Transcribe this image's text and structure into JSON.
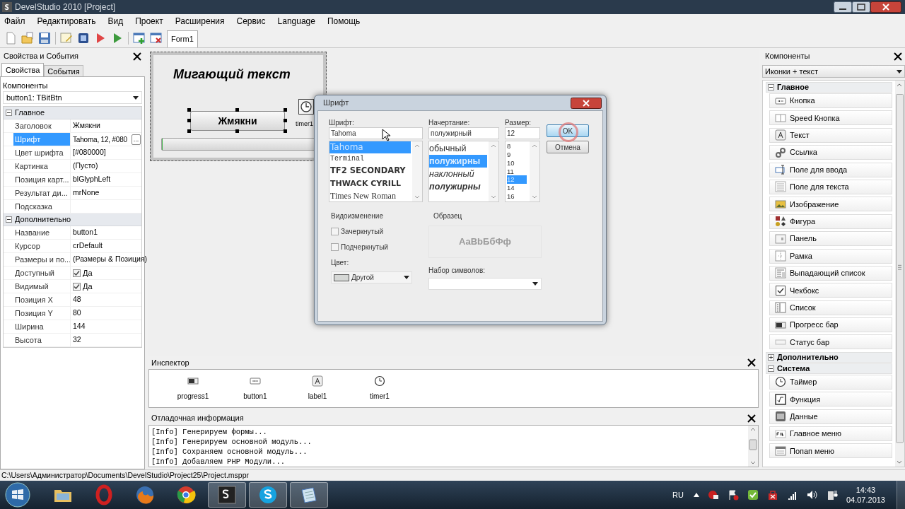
{
  "window": {
    "title": "DevelStudio 2010 [Project]"
  },
  "menu": [
    "Файл",
    "Редактировать",
    "Вид",
    "Проект",
    "Расширения",
    "Сервис",
    "Language",
    "Помощь"
  ],
  "toolbar": {
    "tabs": [
      {
        "label": "Form1",
        "selected": true
      }
    ]
  },
  "properties": {
    "title": "Свойства и События",
    "tabs": [
      {
        "label": "Свойства",
        "selected": true
      },
      {
        "label": "События",
        "selected": false
      }
    ],
    "components_label": "Компоненты",
    "component_select": "button1: TBitBtn",
    "groups": [
      {
        "title": "Главное",
        "expanded": true,
        "rows": [
          {
            "kind": "text",
            "name": "Заголовок",
            "value": "Жмякни",
            "selected": false
          },
          {
            "kind": "button",
            "name": "Шрифт",
            "value": "Tahoma, 12, #080",
            "button_label": "...",
            "selected": true
          },
          {
            "kind": "text",
            "name": "Цвет шрифта",
            "value": "[#080000]",
            "selected": false
          },
          {
            "kind": "text",
            "name": "Картинка",
            "value": "(Пусто)",
            "selected": false
          },
          {
            "kind": "text",
            "name": "Позиция карт...",
            "value": "blGlyphLeft",
            "selected": false
          },
          {
            "kind": "text",
            "name": "Результат ди...",
            "value": "mrNone",
            "selected": false
          },
          {
            "kind": "text",
            "name": "Подсказка",
            "selected": false
          }
        ]
      },
      {
        "title": "Дополнительно",
        "expanded": true,
        "rows": [
          {
            "kind": "text",
            "name": "Название",
            "value": "button1",
            "selected": false
          },
          {
            "kind": "text",
            "name": "Курсор",
            "value": "crDefault",
            "selected": false
          },
          {
            "kind": "text",
            "name": "Размеры и по...",
            "value": "(Размеры & Позиция)",
            "selected": false
          },
          {
            "kind": "checkbox",
            "name": "Доступный",
            "value": "Да",
            "checked": true,
            "selected": false
          },
          {
            "kind": "checkbox",
            "name": "Видимый",
            "value": "Да",
            "checked": true,
            "selected": false
          },
          {
            "kind": "text",
            "name": "Позиция X",
            "value": "48",
            "selected": false
          },
          {
            "kind": "text",
            "name": "Позиция Y",
            "value": "80",
            "selected": false
          },
          {
            "kind": "text",
            "name": "Ширина",
            "value": "144",
            "selected": false
          },
          {
            "kind": "text",
            "name": "Высота",
            "value": "32",
            "selected": false
          }
        ]
      }
    ]
  },
  "designer": {
    "form_label": "Мигающий текст",
    "button_label": "Жмякни",
    "timer_label": "timer1",
    "progress": {
      "level": 0
    }
  },
  "font_dialog": {
    "title": "Шрифт",
    "font_label": "Шрифт:",
    "font_value": "Tahoma",
    "fonts": [
      {
        "label": "Tahoma",
        "kind": "sans",
        "selected": true
      },
      {
        "label": "Terminal",
        "kind": "mono",
        "selected": false
      },
      {
        "label": "TF2 SECONDARY",
        "kind": "display",
        "selected": false
      },
      {
        "label": "THWACK CYRILL",
        "kind": "heavy",
        "selected": false
      },
      {
        "label": "Times New Roman",
        "kind": "serif",
        "selected": false
      }
    ],
    "style_label": "Начертание:",
    "style_value": "полужирный",
    "styles": [
      {
        "label": "обычный",
        "kind": "regular",
        "selected": false
      },
      {
        "label": "полужирны",
        "kind": "bold",
        "selected": true
      },
      {
        "label": "наклонный",
        "kind": "italic",
        "selected": false
      },
      {
        "label": "полужирны",
        "kind": "bolditalic",
        "selected": false
      }
    ],
    "size_label": "Размер:",
    "size_value": "12",
    "sizes": [
      {
        "label": "8",
        "selected": false
      },
      {
        "label": "9",
        "selected": false
      },
      {
        "label": "10",
        "selected": false
      },
      {
        "label": "11",
        "selected": false
      },
      {
        "label": "12",
        "selected": true
      },
      {
        "label": "14",
        "selected": false
      },
      {
        "label": "16",
        "selected": false
      }
    ],
    "ok": "OK",
    "cancel": "Отмена",
    "effects_title": "Видоизменение",
    "effects": [
      {
        "label": "Зачеркнутый",
        "checked": false
      },
      {
        "label": "Подчеркнутый",
        "checked": false
      }
    ],
    "color_label": "Цвет:",
    "color_value": "Другой",
    "sample_title": "Образец",
    "sample_text": "AaBbБбФф",
    "charset_label": "Набор символов:"
  },
  "inspector": {
    "title": "Инспектор",
    "items": [
      {
        "label": "progress1",
        "kind": "progress"
      },
      {
        "label": "button1",
        "kind": "button"
      },
      {
        "label": "label1",
        "kind": "label"
      },
      {
        "label": "timer1",
        "kind": "timer"
      }
    ]
  },
  "debug": {
    "title": "Отладочная информация",
    "lines": [
      "[Info] Генерируем формы...",
      "[Info] Генерируем основной модуль...",
      "[Info] Сохраняем основной модуль...",
      "[Info] Добавляем PHP Модули..."
    ]
  },
  "components": {
    "title": "Компоненты",
    "view_select": "Иконки + текст",
    "groups": [
      {
        "title": "Главное",
        "expanded": true,
        "items": [
          {
            "label": "Кнопка",
            "kind": "button"
          },
          {
            "label": "Speed Кнопка",
            "kind": "speedbutton"
          },
          {
            "label": "Текст",
            "kind": "label"
          },
          {
            "label": "Ссылка",
            "kind": "link"
          },
          {
            "label": "Поле для ввода",
            "kind": "edit"
          },
          {
            "label": "Поле для текста",
            "kind": "memo"
          },
          {
            "label": "Изображение",
            "kind": "image"
          },
          {
            "label": "Фигура",
            "kind": "shape"
          },
          {
            "label": "Панель",
            "kind": "panel"
          },
          {
            "label": "Рамка",
            "kind": "frame"
          },
          {
            "label": "Выпадающий список",
            "kind": "combobox"
          },
          {
            "label": "Чекбокс",
            "kind": "checkbox"
          },
          {
            "label": "Список",
            "kind": "listbox"
          },
          {
            "label": "Прогресс бар",
            "kind": "progress"
          },
          {
            "label": "Статус бар",
            "kind": "statusbar"
          }
        ]
      },
      {
        "title": "Дополнительно",
        "expanded": false
      },
      {
        "title": "Система",
        "expanded": true,
        "items": [
          {
            "label": "Таймер",
            "kind": "timer"
          },
          {
            "label": "Функция",
            "kind": "function"
          },
          {
            "label": "Данные",
            "kind": "data"
          },
          {
            "label": "Главное меню",
            "kind": "mainmenu"
          },
          {
            "label": "Попап меню",
            "kind": "popupmenu"
          }
        ]
      }
    ]
  },
  "status_bar": {
    "path": "C:\\Users\\Администратор\\Documents\\DevelStudio\\Project25\\Project.msppr"
  },
  "taskbar": {
    "apps": [
      {
        "kind": "folder",
        "active": false
      },
      {
        "kind": "opera",
        "active": false
      },
      {
        "kind": "firefox",
        "active": false
      },
      {
        "kind": "chrome",
        "active": false
      },
      {
        "kind": "develstudio",
        "active": true
      },
      {
        "kind": "skype",
        "active": true
      },
      {
        "kind": "notepad",
        "active": true
      }
    ],
    "language": "RU",
    "time": "14:43",
    "date": "04.07.2013"
  }
}
